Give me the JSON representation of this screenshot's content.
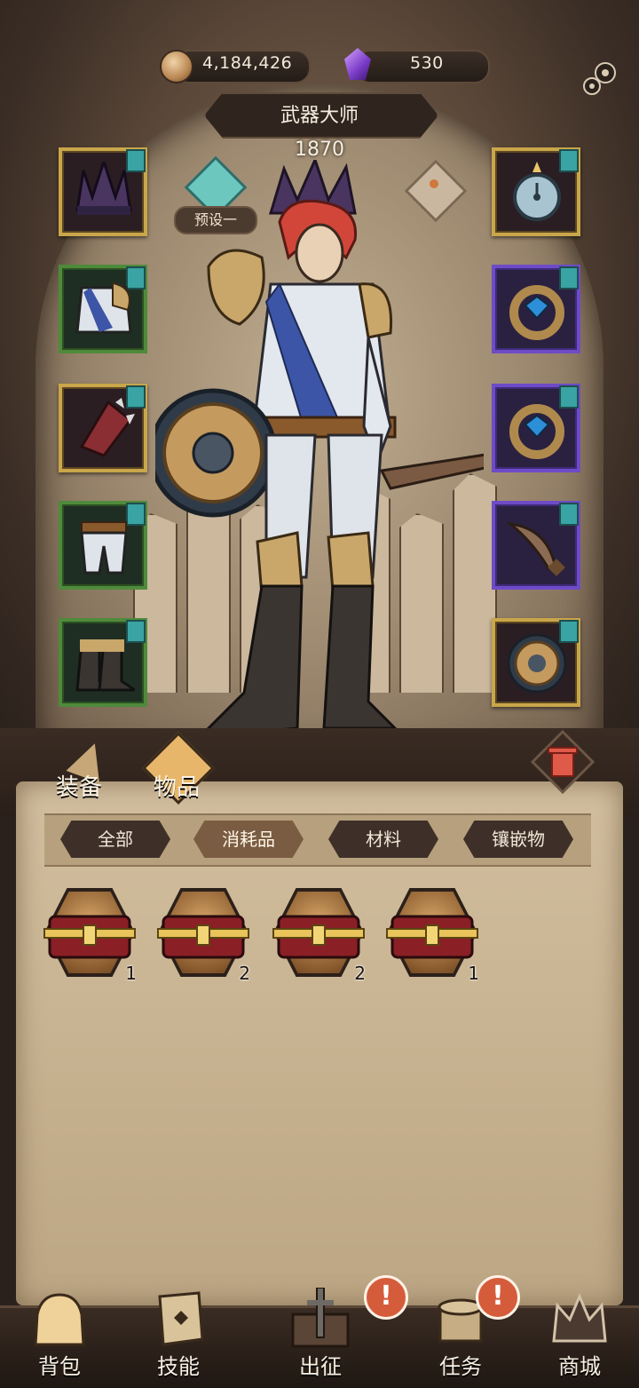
{
  "resources": {
    "coins": "4,184,426",
    "gems": "530"
  },
  "hero": {
    "title": "武器大师",
    "power": "1870",
    "preset_label": "预设一"
  },
  "equipment": {
    "left": [
      {
        "name": "crown",
        "rarity": "gold"
      },
      {
        "name": "armor",
        "rarity": "green"
      },
      {
        "name": "gauntlet",
        "rarity": "gold"
      },
      {
        "name": "pants",
        "rarity": "green"
      },
      {
        "name": "boots",
        "rarity": "green"
      }
    ],
    "right": [
      {
        "name": "pocket-watch",
        "rarity": "gold"
      },
      {
        "name": "ring",
        "rarity": "purple"
      },
      {
        "name": "ring",
        "rarity": "purple"
      },
      {
        "name": "dagger",
        "rarity": "purple"
      },
      {
        "name": "shield",
        "rarity": "gold"
      }
    ]
  },
  "tabs": {
    "equipment": "装备",
    "items": "物品"
  },
  "filters": [
    "全部",
    "消耗品",
    "材料",
    "镶嵌物"
  ],
  "active_filter": "消耗品",
  "inventory": [
    {
      "name": "treasure-chest",
      "count": "1"
    },
    {
      "name": "treasure-chest",
      "count": "2"
    },
    {
      "name": "treasure-chest",
      "count": "2"
    },
    {
      "name": "treasure-chest",
      "count": "1"
    }
  ],
  "nav": {
    "bag": "背包",
    "skills": "技能",
    "expedition": "出征",
    "quests": "任务",
    "shop": "商城",
    "alert_glyph": "!"
  },
  "colors": {
    "gold_frame": "#c9a64a",
    "green_frame": "#4f8a3b",
    "purple_frame": "#6e4bc7",
    "alert": "#d55c3b"
  }
}
